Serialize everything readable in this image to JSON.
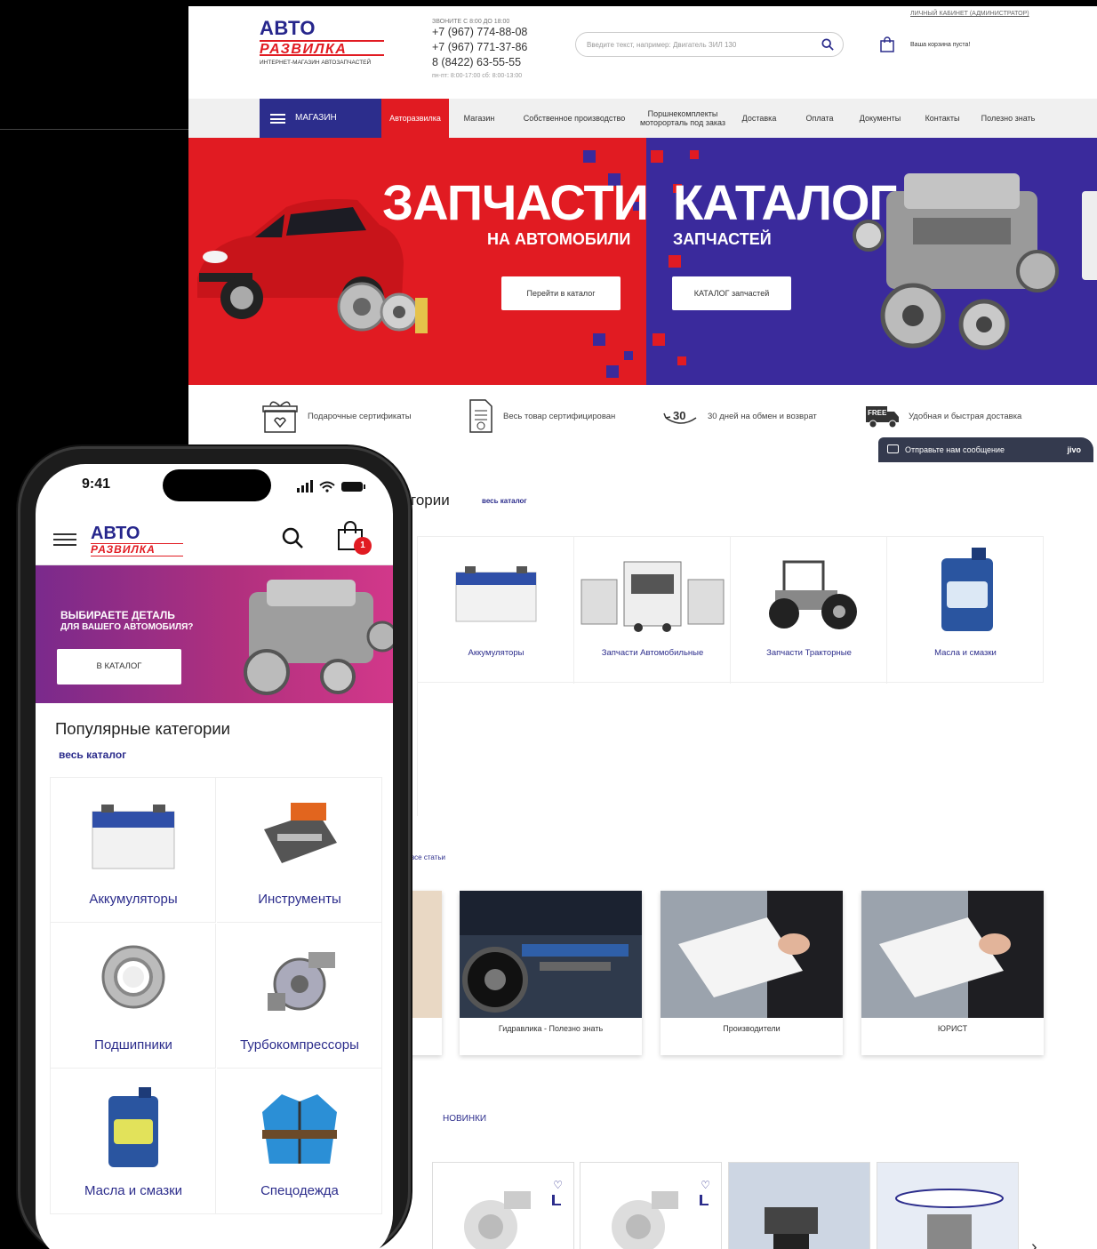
{
  "desktop": {
    "logo": {
      "top": "АВТО",
      "bottom": "РАЗВИЛКА",
      "sub": "ИНТЕРНЕТ-МАГАЗИН АВТОЗАПЧАСТЕЙ"
    },
    "call_caption": "ЗВОНИТЕ С 8:00 ДО 18:00",
    "phones": [
      "+7 (967) 774-88-08",
      "+7 (967) 771-37-86",
      "8 (8422) 63-55-55"
    ],
    "hours": "пн-пт: 8:00-17:00 сб: 8:00-13:00",
    "search_placeholder": "Введите текст, например: Двигатель ЗИЛ 130",
    "account_link": "ЛИЧНЫЙ КАБИНЕТ (АДМИНИСТРАТОР)",
    "cart_text": "Ваша корзина пуста!",
    "nav": {
      "catalog_button": "МАГАЗИН",
      "active": "Авторазвилка",
      "items": [
        "Магазин",
        "Собственное производство",
        "Поршнекомплекты моторорталь под заказ",
        "Доставка",
        "Оплата",
        "Документы",
        "Контакты",
        "Полезно знать"
      ]
    },
    "banner": {
      "left_title": "ЗАПЧАСТИ",
      "left_subtitle": "НА АВТОМОБИЛИ",
      "left_button": "Перейти в каталог",
      "right_title": "КАТАЛОГ",
      "right_subtitle": "ЗАПЧАСТЕЙ",
      "right_button": "КАТАЛОГ запчастей"
    },
    "advantages": [
      "Подарочные сертификаты",
      "Весь товар сертифицирован",
      "30 дней на обмен и возврат",
      "Удобная и быстрая доставка"
    ],
    "advantage_badge_days": "30",
    "advantage_badge_free": "FREE",
    "chat": {
      "label": "Отправьте нам сообщение",
      "brand": "jivo"
    },
    "categories_title_fragment": "гории",
    "categories_link": "весь каталог",
    "categories": [
      "Аккумуляторы",
      "Запчасти Автомобильные",
      "Запчасти Тракторные",
      "Масла и смазки"
    ],
    "articles_link": "все статьи",
    "articles": [
      "Гидравлика - Полезно знать",
      "Производители",
      "ЮРИСТ"
    ],
    "new_link": "НОВИНКИ"
  },
  "mobile": {
    "time": "9:41",
    "logo": {
      "top": "АВТО",
      "bottom": "РАЗВИЛКА"
    },
    "cart_count": "1",
    "banner": {
      "line1": "ВЫБИРАЕТЕ ДЕТАЛЬ",
      "line2": "ДЛЯ ВАШЕГО АВТОМОБИЛЯ?",
      "button": "В КАТАЛОГ"
    },
    "categories_title": "Популярные категории",
    "categories_link": "весь каталог",
    "categories": [
      "Аккумуляторы",
      "Инструменты",
      "Подшипники",
      "Турбокомпрессоры",
      "Масла и смазки",
      "Спецодежда"
    ]
  },
  "colors": {
    "brand_blue": "#2c2d8c",
    "brand_red": "#e11b22",
    "banner_purple": "#3a2a9c"
  }
}
